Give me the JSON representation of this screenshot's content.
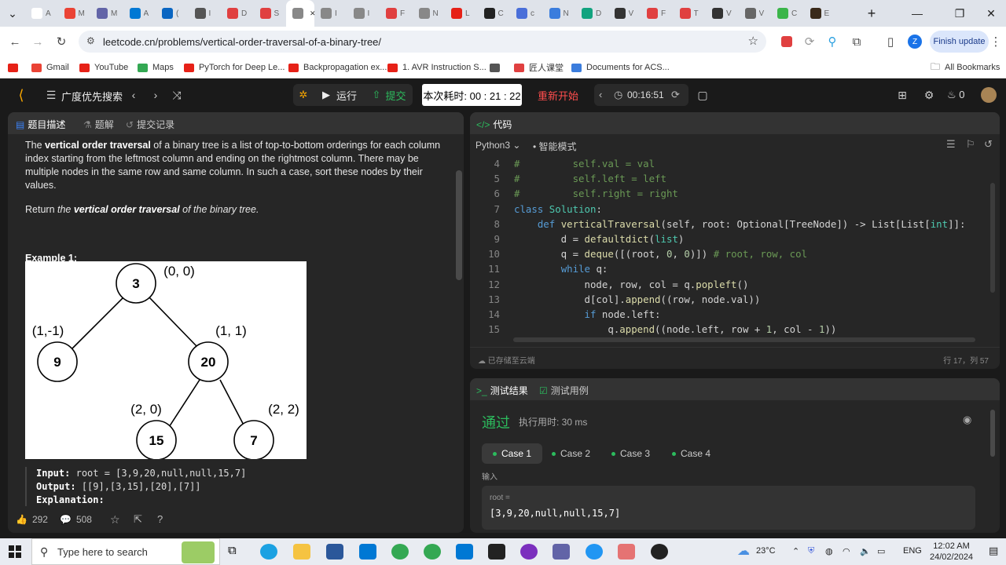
{
  "browser": {
    "tabs": [
      {
        "color": "#ffffff",
        "label": "A"
      },
      {
        "color": "#ea4335",
        "label": "M"
      },
      {
        "color": "#6264a7",
        "label": "M"
      },
      {
        "color": "#0078d4",
        "label": "A"
      },
      {
        "color": "#0a66c2",
        "label": "("
      },
      {
        "color": "#555555",
        "label": "I"
      },
      {
        "color": "#e04040",
        "label": "D"
      },
      {
        "color": "#e04040",
        "label": "S"
      },
      {
        "color": "#888888",
        "label": "S",
        "active": true
      },
      {
        "color": "#888888",
        "label": "I"
      },
      {
        "color": "#888888",
        "label": "I"
      },
      {
        "color": "#e04040",
        "label": "F"
      },
      {
        "color": "#888888",
        "label": "N"
      },
      {
        "color": "#e62117",
        "label": "L"
      },
      {
        "color": "#222222",
        "label": "C"
      },
      {
        "color": "#4a6fd9",
        "label": "c"
      },
      {
        "color": "#3b7ddd",
        "label": "N"
      },
      {
        "color": "#12a37f",
        "label": "D"
      },
      {
        "color": "#333333",
        "label": "V"
      },
      {
        "color": "#e04040",
        "label": "F"
      },
      {
        "color": "#e04040",
        "label": "T"
      },
      {
        "color": "#333333",
        "label": "V"
      },
      {
        "color": "#666666",
        "label": "V"
      },
      {
        "color": "#3bb54a",
        "label": "C"
      },
      {
        "color": "#3a2a1a",
        "label": "E"
      }
    ],
    "new_tab": "+",
    "url": "leetcode.cn/problems/vertical-order-traversal-of-a-binary-tree/",
    "finish_update": "Finish update",
    "profile_initial": "Z",
    "bookmarks": [
      {
        "label": "",
        "color": "#e62117"
      },
      {
        "label": "Gmail",
        "color": "#ea4335"
      },
      {
        "label": "YouTube",
        "color": "#e62117"
      },
      {
        "label": "Maps",
        "color": "#34a853"
      },
      {
        "label": "PyTorch for Deep Le...",
        "color": "#e62117"
      },
      {
        "label": "Backpropagation ex...",
        "color": "#e62117"
      },
      {
        "label": "1. AVR Instruction S...",
        "color": "#e62117"
      },
      {
        "label": "",
        "color": "#555555"
      },
      {
        "label": "匠人课堂",
        "color": "#e04040"
      },
      {
        "label": "Documents for ACS...",
        "color": "#3b7ddd"
      }
    ],
    "all_bookmarks": "All Bookmarks"
  },
  "header": {
    "problem_list": "广度优先搜索",
    "run": "运行",
    "submit": "提交",
    "timer": "本次耗时: 00 : 21 : 22",
    "restart": "重新开始",
    "stopwatch": "00:16:51",
    "points": "0"
  },
  "desc": {
    "tabs": [
      "题目描述",
      "题解",
      "提交记录"
    ],
    "para1_bold": "vertical order traversal",
    "para1_a": "The ",
    "para1_b": " of a binary tree is a list of top-to-bottom orderings for each column index starting from the leftmost column and ending on the rightmost column. There may be multiple nodes in the same row and same column. In such a case, sort these nodes by their values.",
    "para2_a": "Return ",
    "para2_i": "the ",
    "para2_bi": "vertical order traversal",
    "para2_i2": " of the binary tree.",
    "example_title": "Example 1:",
    "tree": {
      "nodes": [
        {
          "value": "3",
          "coord": "(0, 0)"
        },
        {
          "value": "9",
          "coord": "(1,-1)"
        },
        {
          "value": "20",
          "coord": "(1, 1)"
        },
        {
          "value": "15",
          "coord": "(2, 0)"
        },
        {
          "value": "7",
          "coord": "(2, 2)"
        }
      ]
    },
    "input_label": "Input:",
    "input_value": "root = [3,9,20,null,null,15,7]",
    "output_label": "Output:",
    "output_value": "[[9],[3,15],[20],[7]]",
    "explanation_label": "Explanation:",
    "likes": "292",
    "comments": "508"
  },
  "editor": {
    "title": "代码",
    "language": "Python3",
    "mode": "智能模式",
    "lines": [
      {
        "n": "4",
        "text": "#         self.val = val",
        "type": "comment"
      },
      {
        "n": "5",
        "text": "#         self.left = left",
        "type": "comment"
      },
      {
        "n": "6",
        "text": "#         self.right = right",
        "type": "comment"
      },
      {
        "n": "7",
        "text": "class Solution:",
        "type": "class"
      },
      {
        "n": "8",
        "text": "    def verticalTraversal(self, root: Optional[TreeNode]) -> List[List[int]]:",
        "type": "def"
      },
      {
        "n": "9",
        "text": "        d = defaultdict(list)",
        "type": "code"
      },
      {
        "n": "10",
        "text": "        q = deque([(root, 0, 0)]) # root, row, col",
        "type": "code"
      },
      {
        "n": "11",
        "text": "        while q:",
        "type": "code"
      },
      {
        "n": "12",
        "text": "            node, row, col = q.popleft()",
        "type": "code"
      },
      {
        "n": "13",
        "text": "            d[col].append((row, node.val))",
        "type": "code"
      },
      {
        "n": "14",
        "text": "            if node.left:",
        "type": "code"
      },
      {
        "n": "15",
        "text": "                q.append((node.left, row + 1, col - 1))",
        "type": "code"
      }
    ],
    "saved": "已存储至云端",
    "cursor": "行 17，列 57"
  },
  "results": {
    "tab_results": "测试结果",
    "tab_cases": "测试用例",
    "status": "通过",
    "runtime": "执行用时: 30 ms",
    "cases": [
      "Case 1",
      "Case 2",
      "Case 3",
      "Case 4"
    ],
    "input_heading": "输入",
    "var_name": "root =",
    "var_value": "[3,9,20,null,null,15,7]"
  },
  "taskbar": {
    "search_placeholder": "Type here to search",
    "weather": "23°C",
    "lang": "ENG",
    "time": "12:02 AM",
    "date": "24/02/2024"
  }
}
